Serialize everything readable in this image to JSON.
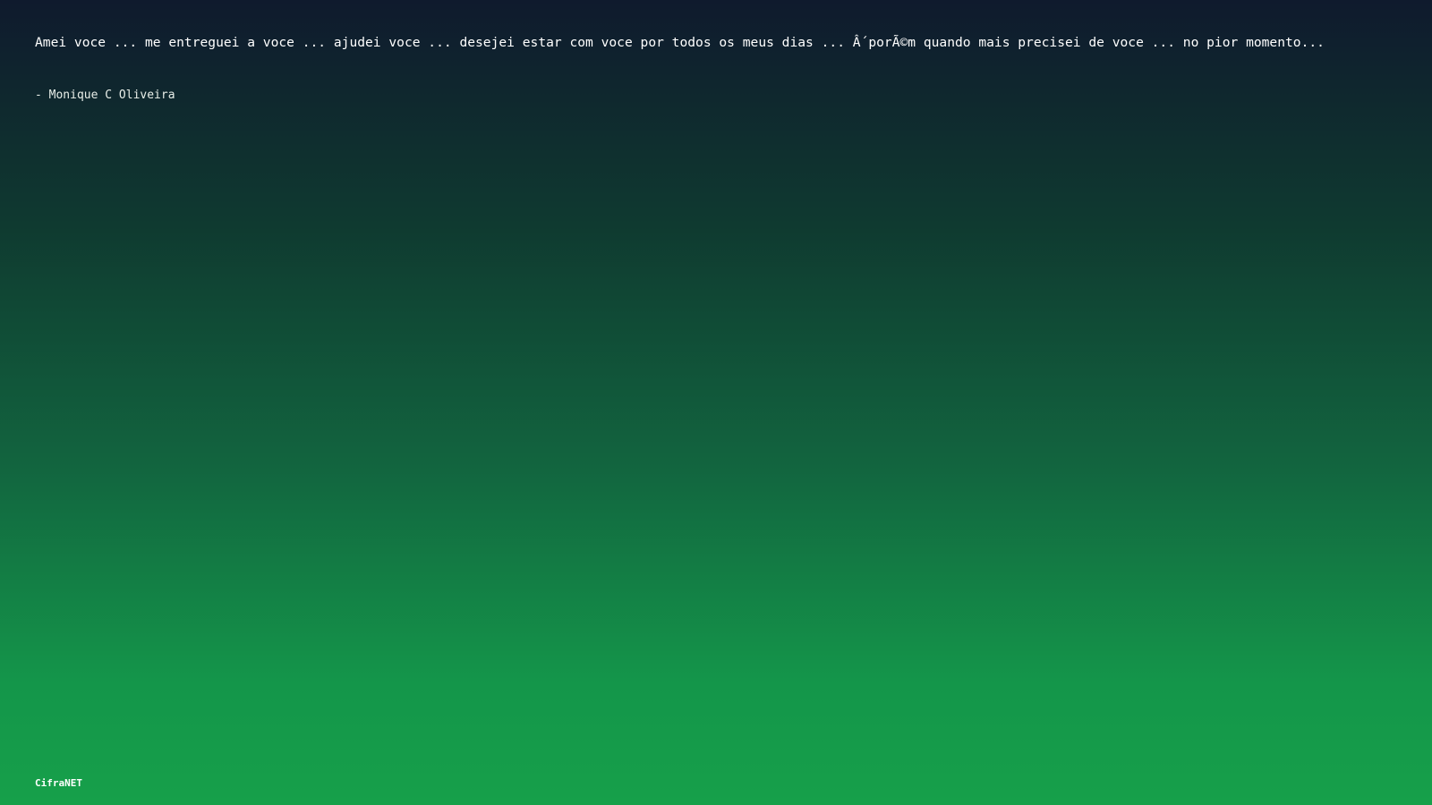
{
  "quote": {
    "text": "Amei voce ... me entreguei a voce ... ajudei voce ... desejei estar com voce por todos os meus dias ... Â´porÃ©m quando mais precisei de voce ... no pior momento...",
    "author": "- Monique C Oliveira"
  },
  "footer": {
    "brand": "CifraNET"
  }
}
